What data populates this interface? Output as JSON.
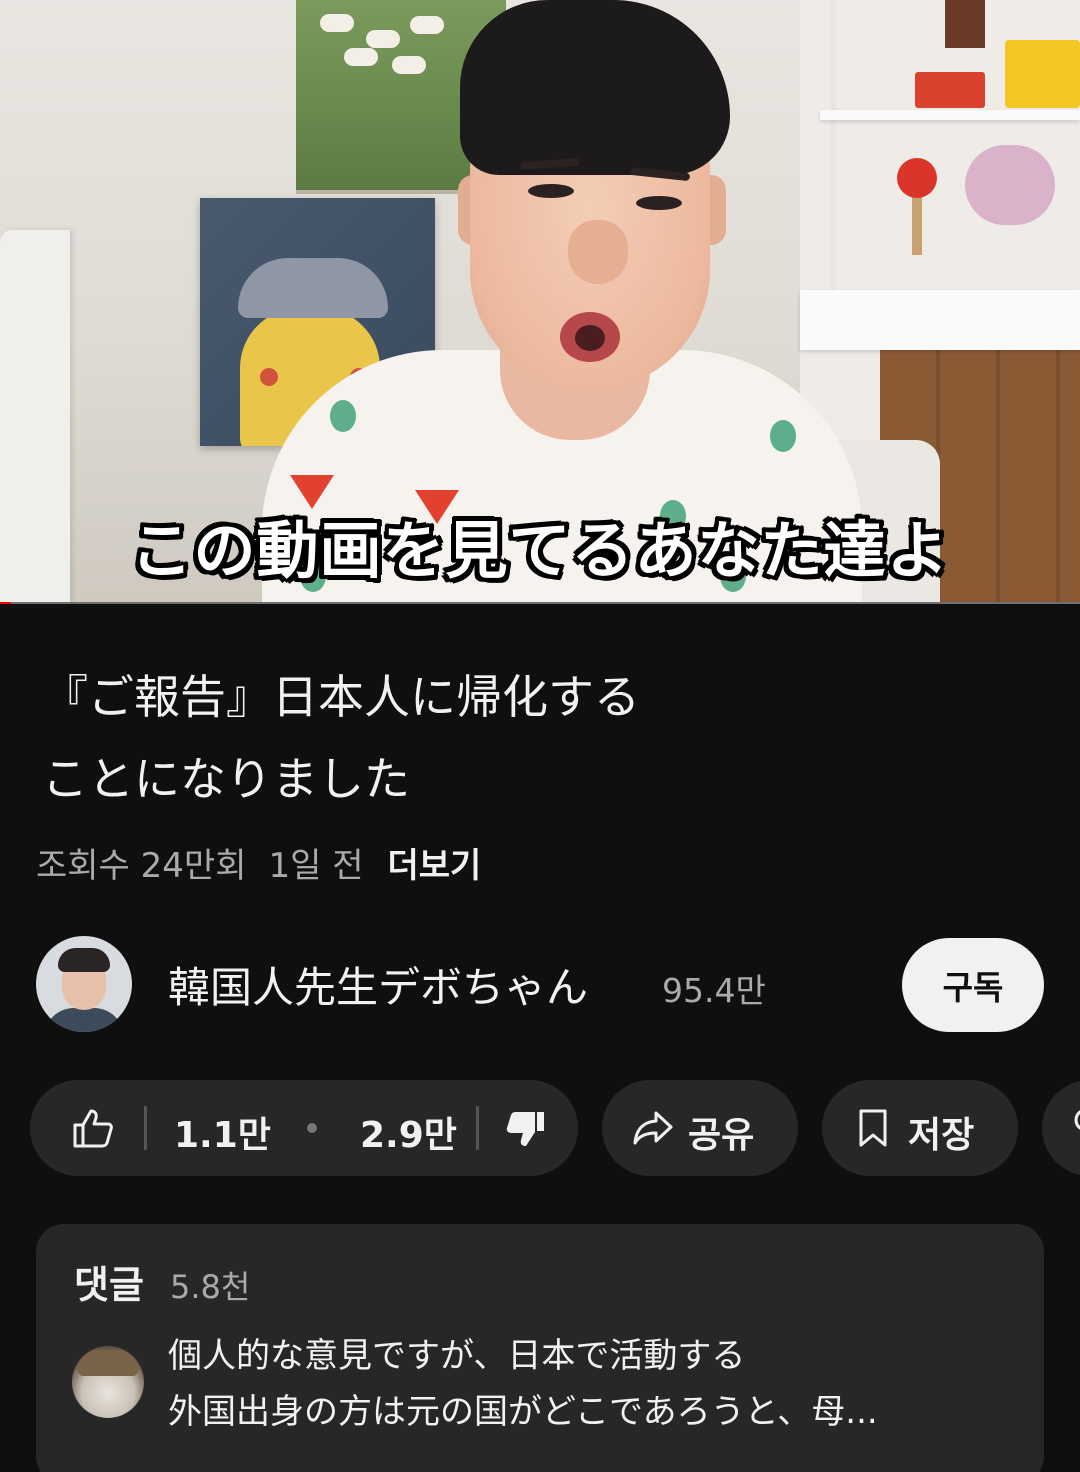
{
  "video": {
    "subtitle": "この動画を見てるあなた達よ",
    "progress_fraction": 0.01
  },
  "info": {
    "title": "『ご報告』日本人に帰化する\nことになりました",
    "views": "조회수 24만회",
    "age": "1일 전",
    "more_label": "더보기"
  },
  "channel": {
    "name": "韓国人先生デボちゃん",
    "subscribers": "95.4만",
    "subscribe_label": "구독"
  },
  "actions": {
    "likes": "1.1만",
    "dislikes": "2.9만",
    "share_label": "공유",
    "save_label": "저장"
  },
  "comments": {
    "label": "댓글",
    "count": "5.8천",
    "top_comment": "個人的な意見ですが、日本で活動する\n外国出身の方は元の国がどこであろうと、母..."
  },
  "colors": {
    "background": "#0f0f0f",
    "pill": "#272727",
    "progress": "#ff0000",
    "subscribe_bg": "#f1f1f1"
  }
}
